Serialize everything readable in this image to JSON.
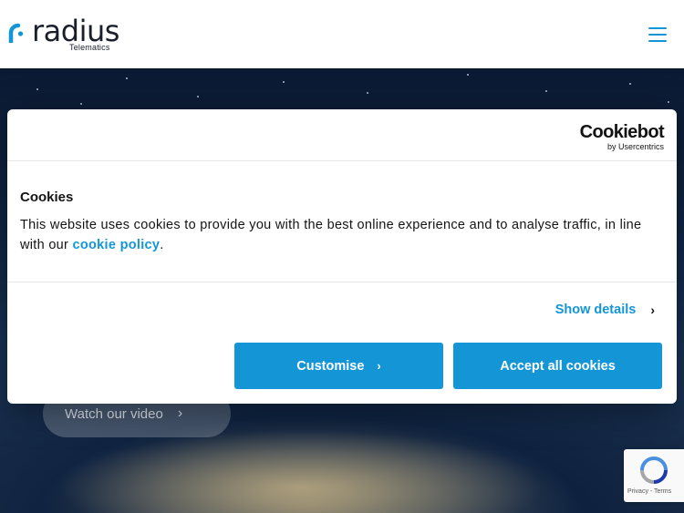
{
  "header": {
    "logo_word": "radius",
    "logo_sub": "Telematics",
    "menu_icon": "hamburger-menu-icon",
    "accent": "#1496d6"
  },
  "hero": {
    "watch_label": "Watch our video",
    "watch_icon": "chevron-right-icon"
  },
  "recaptcha": {
    "footer": "Privacy - Terms",
    "icon": "recaptcha-icon"
  },
  "cookie_dialog": {
    "brand_name": "Cookiebot",
    "brand_sub": "by Usercentrics",
    "title": "Cookies",
    "body_text": "This website uses cookies to provide you with the best online experience and to analyse traffic, in line with our ",
    "policy_link": "cookie policy",
    "body_end": ".",
    "show_details": "Show details",
    "customise": "Customise",
    "accept_all": "Accept all cookies",
    "button_color": "#1496d6"
  }
}
